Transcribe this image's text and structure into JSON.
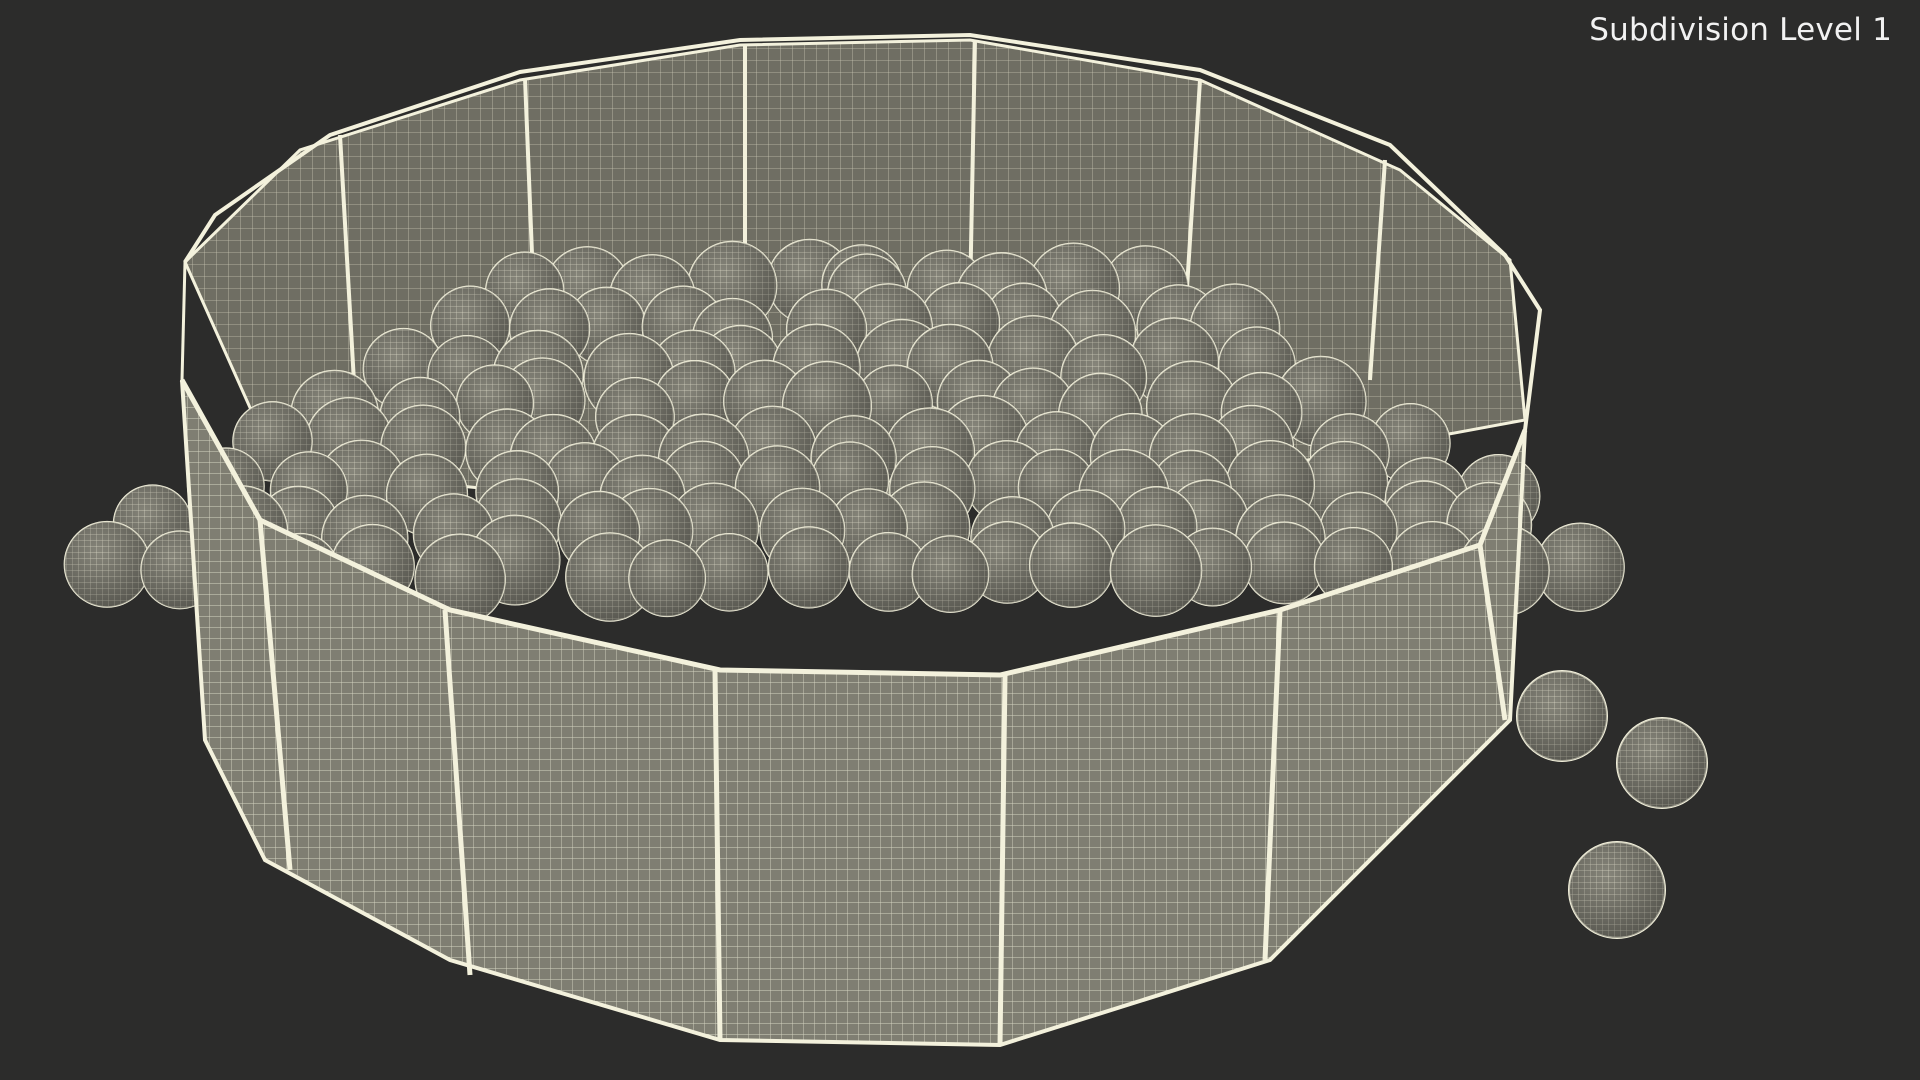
{
  "viewport": {
    "label": "Subdivision Level 1"
  },
  "colors": {
    "background": "#2c2c2b",
    "mesh_fill": "#7f7e72",
    "mesh_fill_dark": "#5e5d53",
    "wire": "#f3f1dc",
    "ball_fill": "#85847a"
  },
  "scene": {
    "object": "ball-pit-wireframe",
    "loose_balls": 3
  }
}
